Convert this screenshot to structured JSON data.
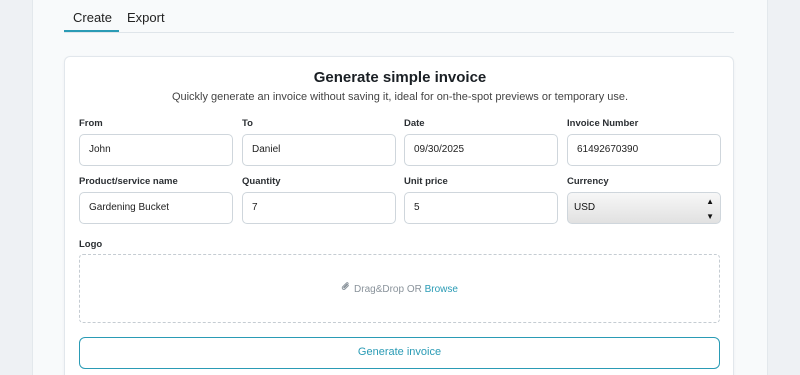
{
  "tabs": [
    {
      "label": "Create",
      "active": true
    },
    {
      "label": "Export",
      "active": false
    }
  ],
  "form": {
    "title": "Generate simple invoice",
    "subtitle": "Quickly generate an invoice without saving it, ideal for on-the-spot previews or temporary use.",
    "fields": {
      "from": {
        "label": "From",
        "value": "John"
      },
      "to": {
        "label": "To",
        "value": "Daniel"
      },
      "date": {
        "label": "Date",
        "value": "09/30/2025"
      },
      "invoice_number": {
        "label": "Invoice Number",
        "value": "61492670390"
      },
      "product": {
        "label": "Product/service name",
        "value": "Gardening Bucket"
      },
      "quantity": {
        "label": "Quantity",
        "value": "7"
      },
      "unit_price": {
        "label": "Unit price",
        "value": "5"
      },
      "currency": {
        "label": "Currency",
        "value": "USD"
      }
    },
    "logo": {
      "label": "Logo",
      "dropzone_text": "Drag&Drop OR ",
      "browse_label": "Browse",
      "icon": "paperclip-icon"
    },
    "submit_label": "Generate invoice"
  },
  "colors": {
    "accent": "#2a9bb5",
    "border": "#cfd6dc",
    "background": "#eef1f4"
  }
}
